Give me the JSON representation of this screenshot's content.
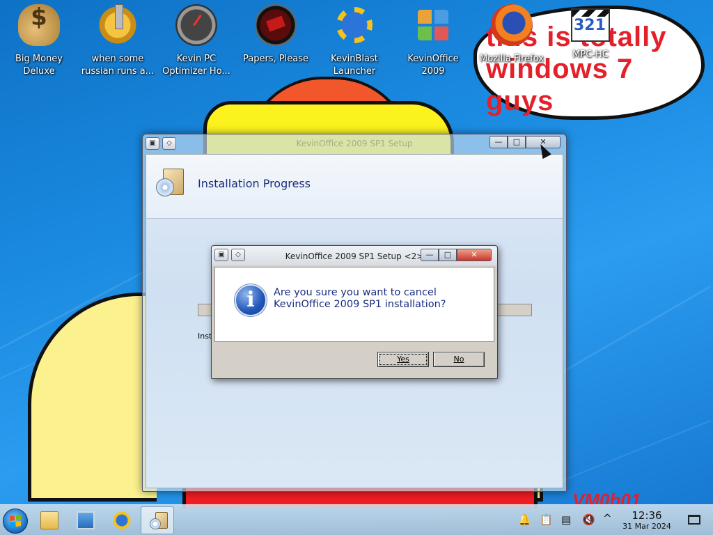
{
  "desktop": {
    "icons": [
      {
        "label": "Big Money\nDeluxe",
        "icon": "money-bag-icon"
      },
      {
        "label": "when some\nrussian runs a...",
        "icon": "gear-lever-icon"
      },
      {
        "label": "Kevin PC\nOptimizer Ho...",
        "icon": "gauge-icon"
      },
      {
        "label": "Papers, Please",
        "icon": "papers-please-icon"
      },
      {
        "label": "KevinBlast\nLauncher",
        "icon": "kevinblast-icon"
      },
      {
        "label": "KevinOffice\n2009",
        "icon": "office-icon"
      },
      {
        "label": "Mozilla Firefox",
        "icon": "firefox-icon"
      },
      {
        "label": "MPC-HC",
        "icon": "mpc-hc-icon"
      }
    ],
    "bubble_text": "this is totally windows 7 guys",
    "watermark": "VM0b01"
  },
  "installer": {
    "title": "KevinOffice 2009 SP1 Setup",
    "header_title": "Installation Progress",
    "status_label": "Insta",
    "menu_glyph": "◇",
    "min_label": "—",
    "max_label": "□",
    "close_label": "✕"
  },
  "confirm_dialog": {
    "title": "KevinOffice 2009 SP1 Setup <2>",
    "message_line1": "Are you sure you want to cancel",
    "message_line2": "KevinOffice 2009 SP1 installation?",
    "yes_label": "Yes",
    "no_label": "No",
    "menu_glyph": "◇",
    "min_label": "—",
    "max_label": "□",
    "close_label": "✕",
    "info_glyph": "i"
  },
  "taskbar": {
    "apps": [
      "file-manager",
      "system-monitor",
      "kevinblast",
      "kevinoffice-setup"
    ],
    "tray": {
      "bell": "🔔",
      "clipboard": "📋",
      "storage": "▤",
      "volume": "🔇",
      "expand": "^"
    },
    "clock_time": "12:36",
    "clock_date": "31 Mar 2024"
  }
}
